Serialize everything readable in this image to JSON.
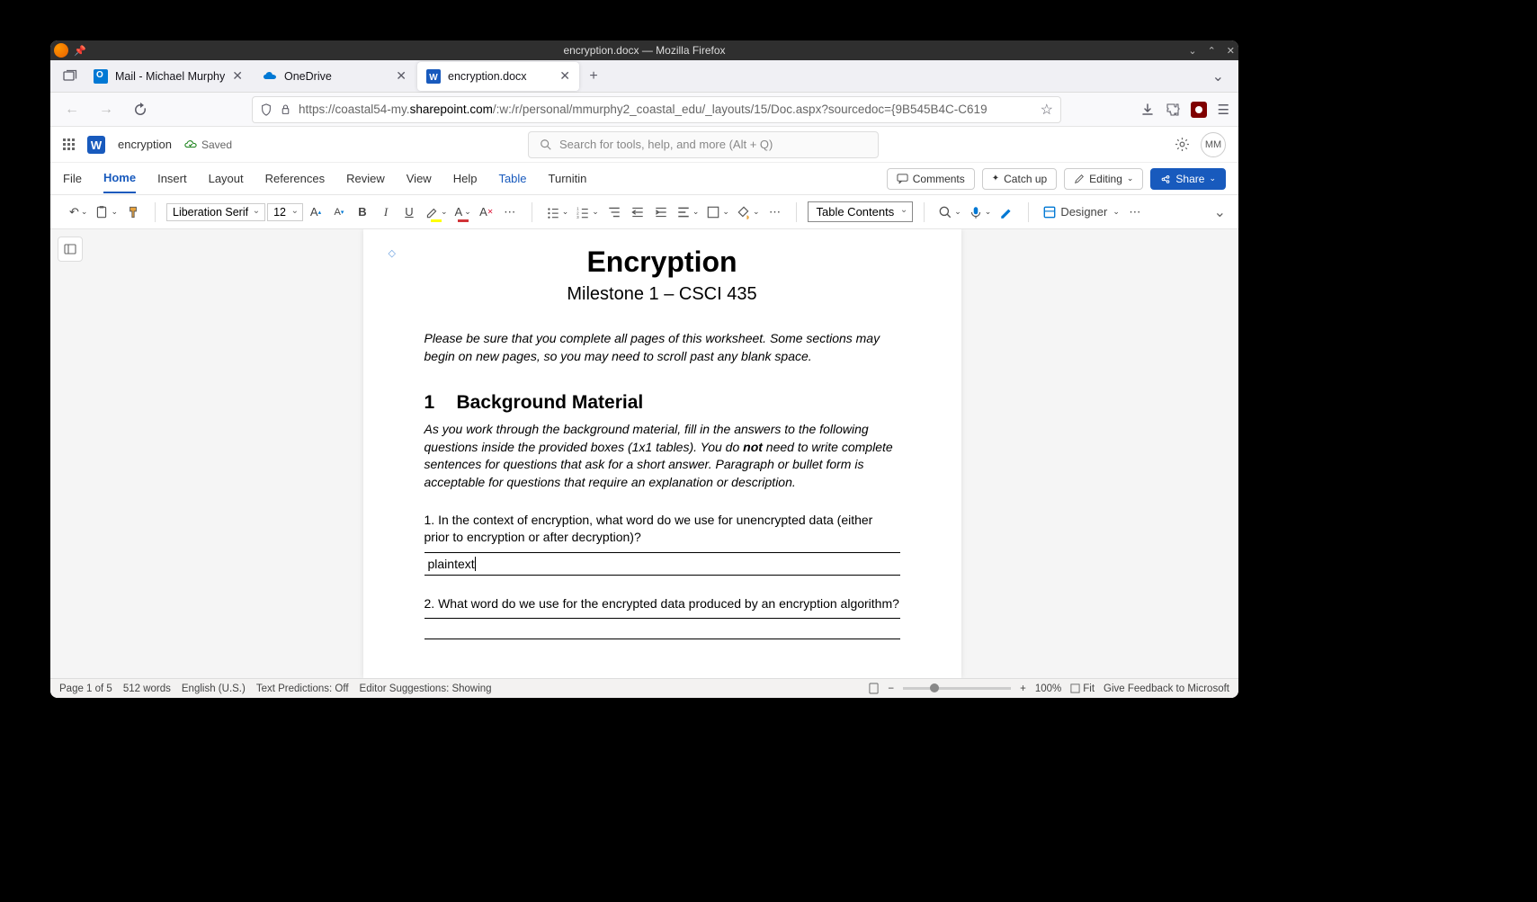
{
  "titlebar": {
    "title": "encryption.docx — Mozilla Firefox"
  },
  "tabs": [
    {
      "label": "Mail - Michael Murphy",
      "icon": "outlook",
      "active": false
    },
    {
      "label": "OneDrive",
      "icon": "onedrive",
      "active": false
    },
    {
      "label": "encryption.docx",
      "icon": "word",
      "active": true
    }
  ],
  "url": {
    "prefix": "https://coastal54-my.",
    "domain": "sharepoint.com",
    "suffix": "/:w:/r/personal/mmurphy2_coastal_edu/_layouts/15/Doc.aspx?sourcedoc={9B545B4C-C619"
  },
  "word_header": {
    "doc_name": "encryption",
    "save_status": "Saved",
    "search_placeholder": "Search for tools, help, and more (Alt + Q)",
    "avatar": "MM"
  },
  "ribbon": {
    "tabs": [
      "File",
      "Home",
      "Insert",
      "Layout",
      "References",
      "Review",
      "View",
      "Help",
      "Table",
      "Turnitin"
    ],
    "active": "Home",
    "comments": "Comments",
    "catchup": "Catch up",
    "editing": "Editing",
    "share": "Share"
  },
  "toolbar": {
    "font": "Liberation Serif",
    "size": "12",
    "style": "Table Contents",
    "designer": "Designer"
  },
  "document": {
    "title": "Encryption",
    "subtitle": "Milestone 1 – CSCI 435",
    "note": "Please be sure that you complete all pages of this worksheet. Some sections may begin on new pages, so you may need to scroll past any blank space.",
    "section1_num": "1",
    "section1_title": "Background Material",
    "section1_intro_a": "As you work through the background material, fill in the answers to the following questions inside the provided boxes (1x1 tables). You do ",
    "section1_intro_not": "not",
    "section1_intro_b": " need to write complete sentences for questions that ask for a short answer. Paragraph or bullet form is acceptable for questions that require an explanation or description.",
    "q1": "1. In the context of encryption, what word do we use for unencrypted data (either prior to encryption or after decryption)?",
    "a1": "plaintext",
    "q2": "2. What word do we use for the encrypted data produced by an encryption algorithm?",
    "a2": ""
  },
  "statusbar": {
    "page": "Page 1 of 5",
    "words": "512 words",
    "lang": "English (U.S.)",
    "predictions": "Text Predictions: Off",
    "suggestions": "Editor Suggestions: Showing",
    "zoom": "100%",
    "fit": "Fit",
    "feedback": "Give Feedback to Microsoft"
  }
}
